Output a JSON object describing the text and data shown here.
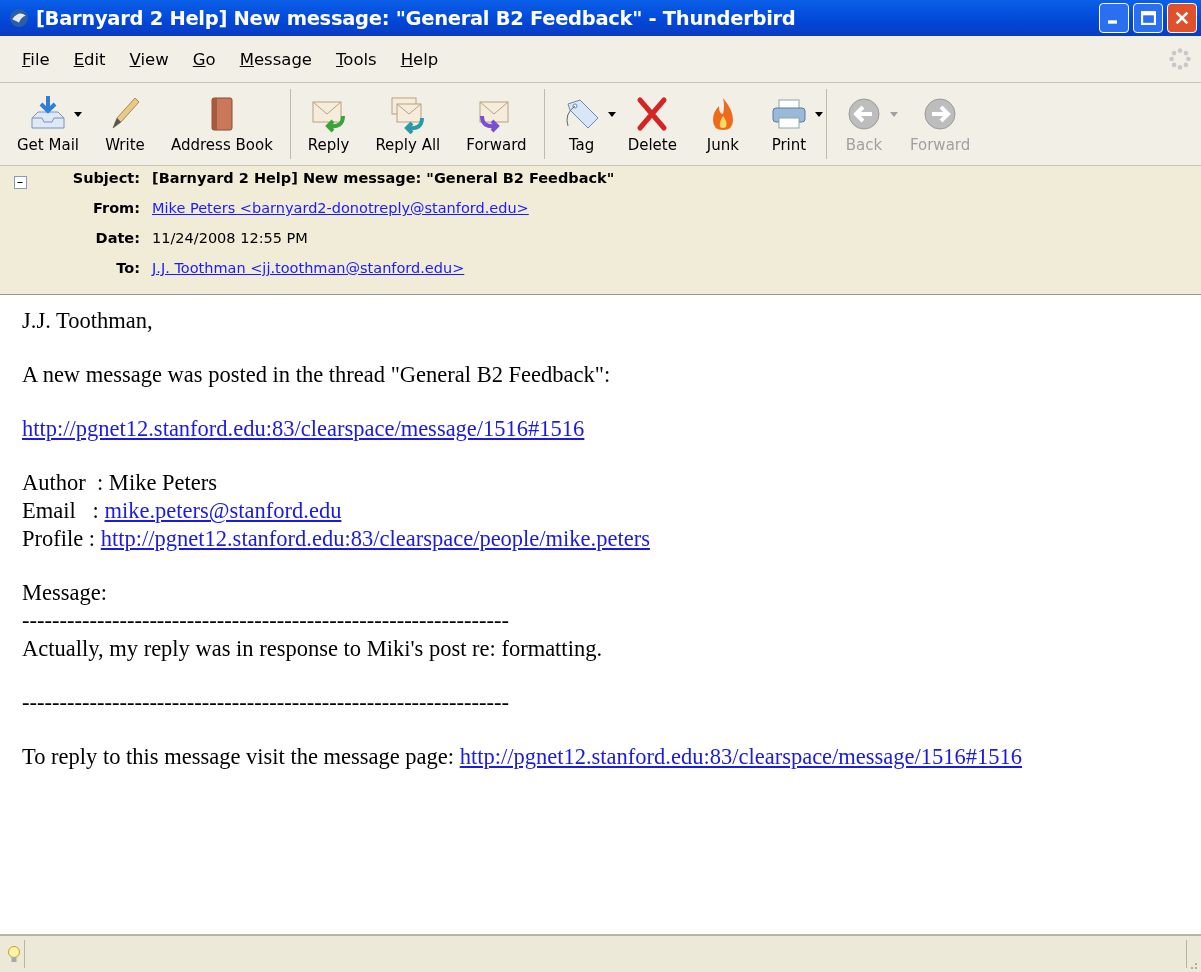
{
  "window": {
    "title": "[Barnyard 2 Help] New message: \"General B2 Feedback\" - Thunderbird"
  },
  "menu": [
    "File",
    "Edit",
    "View",
    "Go",
    "Message",
    "Tools",
    "Help"
  ],
  "toolbar": [
    [
      {
        "kind": "get-mail",
        "label": "Get Mail",
        "dropdown": true,
        "disabled": false
      },
      {
        "kind": "write",
        "label": "Write",
        "dropdown": false,
        "disabled": false
      },
      {
        "kind": "address-book",
        "label": "Address Book",
        "dropdown": false,
        "disabled": false
      }
    ],
    [
      {
        "kind": "reply",
        "label": "Reply",
        "dropdown": false,
        "disabled": false
      },
      {
        "kind": "reply-all",
        "label": "Reply All",
        "dropdown": false,
        "disabled": false
      },
      {
        "kind": "forward",
        "label": "Forward",
        "dropdown": false,
        "disabled": false
      }
    ],
    [
      {
        "kind": "tag",
        "label": "Tag",
        "dropdown": true,
        "disabled": false
      },
      {
        "kind": "delete",
        "label": "Delete",
        "dropdown": false,
        "disabled": false
      },
      {
        "kind": "junk",
        "label": "Junk",
        "dropdown": false,
        "disabled": false
      },
      {
        "kind": "print",
        "label": "Print",
        "dropdown": true,
        "disabled": false
      }
    ],
    [
      {
        "kind": "back",
        "label": "Back",
        "dropdown": true,
        "disabled": true
      },
      {
        "kind": "forward-nav",
        "label": "Forward",
        "dropdown": false,
        "disabled": true
      }
    ]
  ],
  "header": {
    "expanded": true,
    "fields": [
      {
        "label": "Subject:",
        "value": "[Barnyard 2 Help] New message: \"General B2 Feedback\"",
        "kind": "subject"
      },
      {
        "label": "From:",
        "value": "Mike Peters <barnyard2-donotreply@stanford.edu>",
        "kind": "link"
      },
      {
        "label": "Date:",
        "value": "11/24/2008 12:55 PM",
        "kind": "text"
      },
      {
        "label": "To:",
        "value": "J.J. Toothman <jj.toothman@stanford.edu>",
        "kind": "link"
      }
    ]
  },
  "body": [
    [
      {
        "text": "J.J. Toothman,"
      }
    ],
    [
      {
        "text": "A new message was posted in the thread \"General B2 Feedback\":"
      }
    ],
    [
      {
        "link": "http://pgnet12.stanford.edu:83/clearspace/message/1516#1516"
      }
    ],
    [
      {
        "text": "Author  : Mike Peters"
      },
      {
        "text": "Email   : ",
        "link": "mike.peters@stanford.edu"
      },
      {
        "text": "Profile : ",
        "link": "http://pgnet12.stanford.edu:83/clearspace/people/mike.peters"
      }
    ],
    [
      {
        "text": "Message:"
      },
      {
        "text": "-----------------------------------------------------------------"
      },
      {
        "text": "Actually, my reply was in response to Miki's post re: formatting."
      }
    ],
    [
      {
        "text": "-----------------------------------------------------------------"
      }
    ],
    [
      {
        "text": "To reply to this message visit the message page: ",
        "link": "http://pgnet12.stanford.edu:83/clearspace/message/1516#1516"
      }
    ]
  ]
}
